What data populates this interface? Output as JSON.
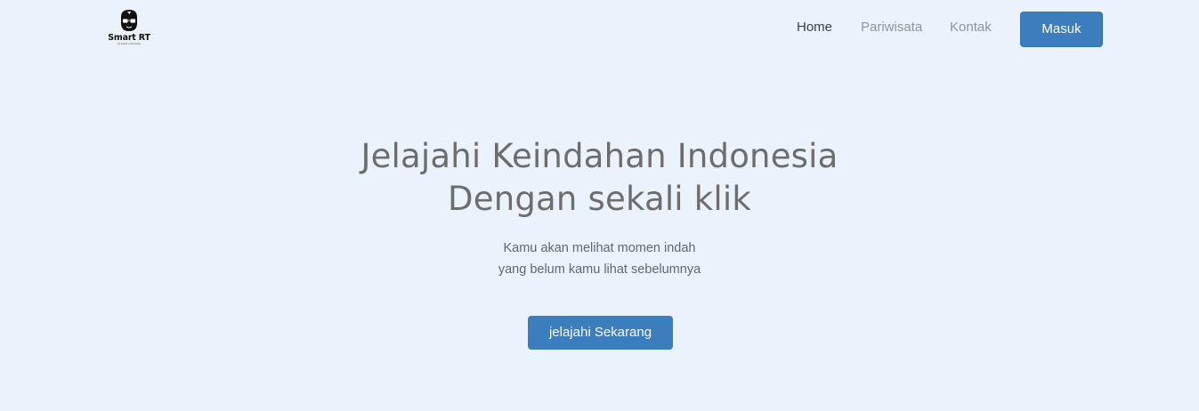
{
  "brand": {
    "name": "Smart RT",
    "tagline": "by smart community",
    "icon": "man-with-glasses-and-cap-icon"
  },
  "nav": {
    "items": [
      {
        "label": "Home",
        "active": true
      },
      {
        "label": "Pariwisata",
        "active": false
      },
      {
        "label": "Kontak",
        "active": false
      }
    ],
    "login_label": "Masuk"
  },
  "hero": {
    "title_line1": "Jelajahi Keindahan Indonesia",
    "title_line2": "Dengan sekali klik",
    "subtitle_line1": "Kamu akan melihat momen indah",
    "subtitle_line2": "yang belum kamu lihat sebelumnya",
    "cta_label": "jelajahi Sekarang"
  },
  "colors": {
    "background": "#eaf2fc",
    "primary": "#3b7dbd",
    "nav_active": "#3a3f44",
    "nav_inactive": "#8f959a",
    "heading": "#6d6d6d"
  }
}
